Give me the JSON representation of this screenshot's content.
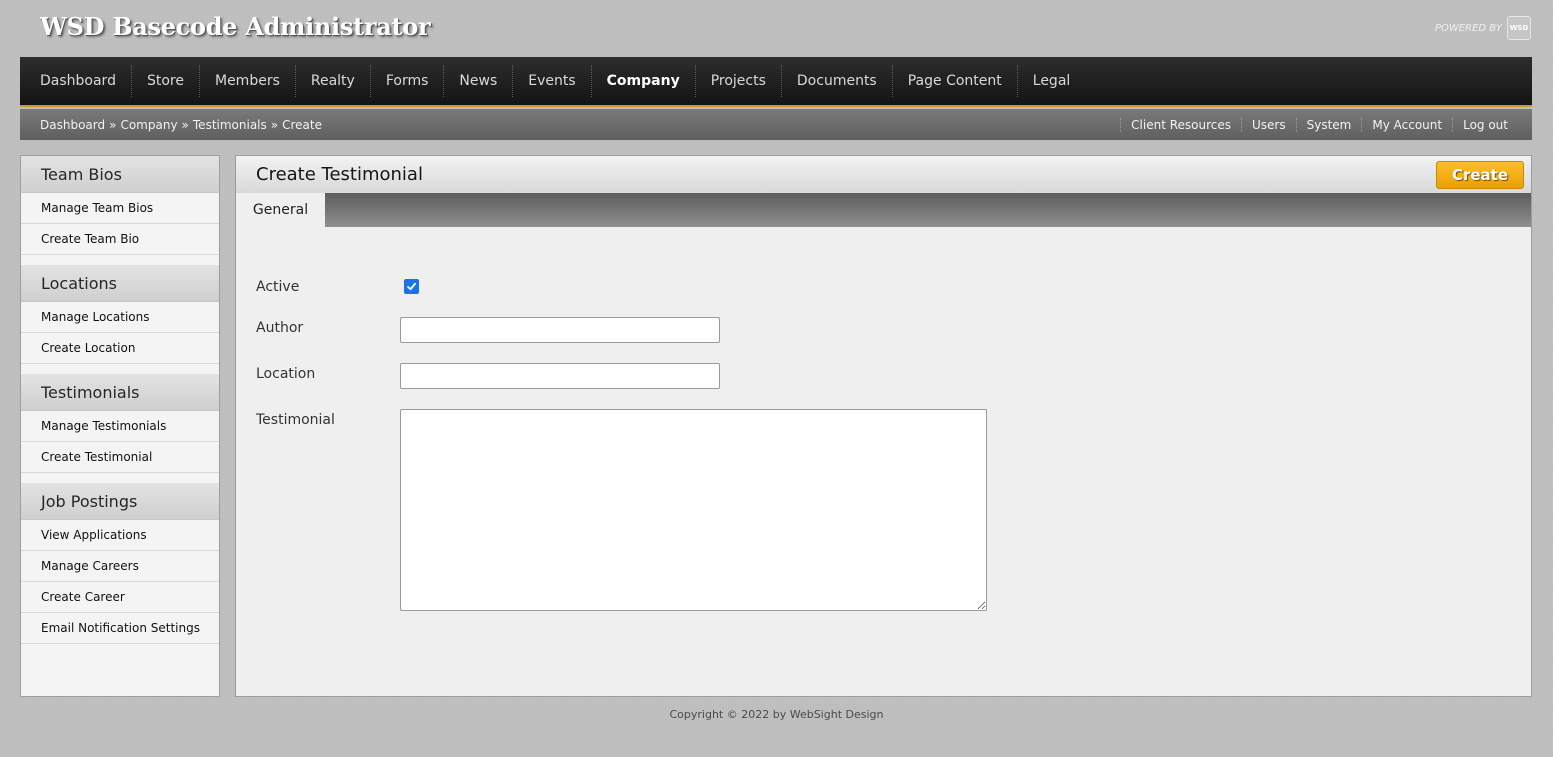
{
  "app": {
    "title": "WSD Basecode Administrator",
    "powered_by": "POWERED BY",
    "logo_text": "WSD"
  },
  "nav": {
    "items": [
      {
        "label": "Dashboard",
        "active": false
      },
      {
        "label": "Store",
        "active": false
      },
      {
        "label": "Members",
        "active": false
      },
      {
        "label": "Realty",
        "active": false
      },
      {
        "label": "Forms",
        "active": false
      },
      {
        "label": "News",
        "active": false
      },
      {
        "label": "Events",
        "active": false
      },
      {
        "label": "Company",
        "active": true
      },
      {
        "label": "Projects",
        "active": false
      },
      {
        "label": "Documents",
        "active": false
      },
      {
        "label": "Page Content",
        "active": false
      },
      {
        "label": "Legal",
        "active": false
      }
    ]
  },
  "breadcrumb": {
    "items": [
      "Dashboard",
      "Company",
      "Testimonials",
      "Create"
    ],
    "separator": "»"
  },
  "utility": {
    "items": [
      "Client Resources",
      "Users",
      "System",
      "My Account",
      "Log out"
    ]
  },
  "sidebar": {
    "sections": [
      {
        "heading": "Team Bios",
        "items": [
          "Manage Team Bios",
          "Create Team Bio"
        ]
      },
      {
        "heading": "Locations",
        "items": [
          "Manage Locations",
          "Create Location"
        ]
      },
      {
        "heading": "Testimonials",
        "items": [
          "Manage Testimonials",
          "Create Testimonial"
        ]
      },
      {
        "heading": "Job Postings",
        "items": [
          "View Applications",
          "Manage Careers",
          "Create Career",
          "Email Notification Settings"
        ]
      }
    ]
  },
  "main": {
    "title": "Create Testimonial",
    "create_label": "Create",
    "tabs": [
      {
        "label": "General",
        "active": true
      }
    ],
    "form": {
      "active_label": "Active",
      "active_checked": true,
      "author_label": "Author",
      "author_value": "",
      "location_label": "Location",
      "location_value": "",
      "testimonial_label": "Testimonial",
      "testimonial_value": ""
    }
  },
  "footer": {
    "text": "Copyright © 2022 by WebSight Design"
  },
  "colors": {
    "accent_orange": "#f5b21a",
    "nav_bg": "#1c1c1c",
    "nav_underline": "#c9982e",
    "checkbox_blue": "#1a73e8"
  }
}
